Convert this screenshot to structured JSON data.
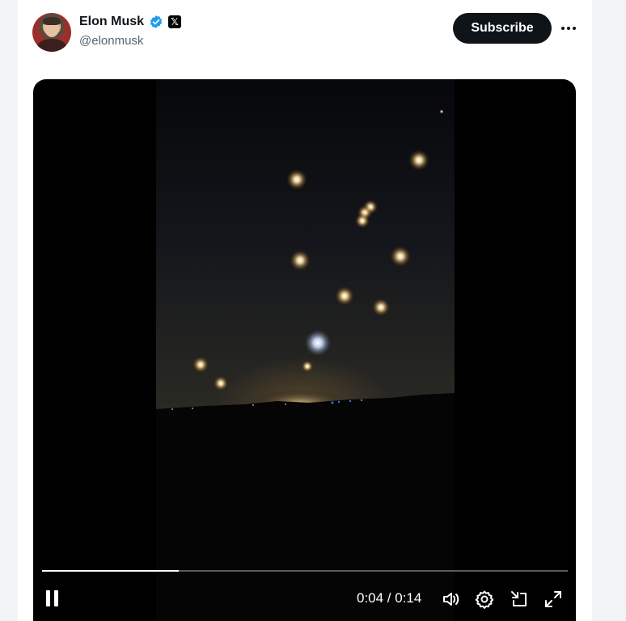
{
  "author": {
    "name": "Elon Musk",
    "handle": "@elonmusk",
    "verified_color": "#1d9bf0",
    "affiliate_badge": "𝕏"
  },
  "header": {
    "subscribe_label": "Subscribe",
    "more_icon": "more-horizontal-icon"
  },
  "video": {
    "time_display": "0:04 / 0:14",
    "progress_fraction": 0.26,
    "icons": [
      "pause-icon",
      "volume-icon",
      "settings-icon",
      "pip-icon",
      "fullscreen-icon"
    ]
  }
}
